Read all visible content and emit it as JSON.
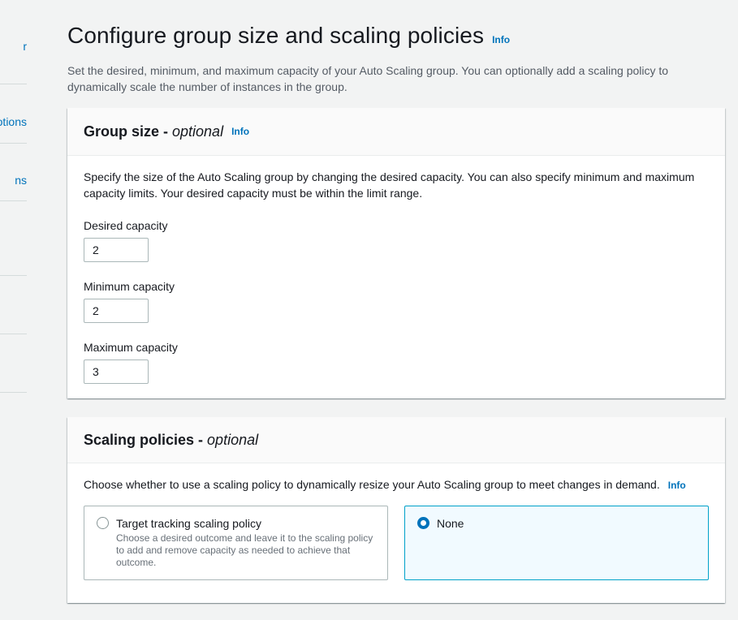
{
  "nav": {
    "frag1": "r",
    "frag2": "otions",
    "frag3": "ns"
  },
  "page": {
    "title": "Configure group size and scaling policies",
    "info": "Info",
    "description": "Set the desired, minimum, and maximum capacity of your Auto Scaling group. You can optionally add a scaling policy to dynamically scale the number of instances in the group."
  },
  "group_size": {
    "title": "Group size - ",
    "title_emph": "optional",
    "info": "Info",
    "description": "Specify the size of the Auto Scaling group by changing the desired capacity. You can also specify minimum and maximum capacity limits. Your desired capacity must be within the limit range.",
    "desired_label": "Desired capacity",
    "desired_value": "2",
    "min_label": "Minimum capacity",
    "min_value": "2",
    "max_label": "Maximum capacity",
    "max_value": "3"
  },
  "scaling": {
    "title": "Scaling policies - ",
    "title_emph": "optional",
    "description": "Choose whether to use a scaling policy to dynamically resize your Auto Scaling group to meet changes in demand.",
    "info": "Info",
    "options": [
      {
        "label": "Target tracking scaling policy",
        "description": "Choose a desired outcome and leave it to the scaling policy to add and remove capacity as needed to achieve that outcome.",
        "selected": false
      },
      {
        "label": "None",
        "description": "",
        "selected": true
      }
    ]
  },
  "colors": {
    "link": "#0073bb",
    "selected_border": "#00a1c9",
    "selected_bg": "#f1faff"
  }
}
